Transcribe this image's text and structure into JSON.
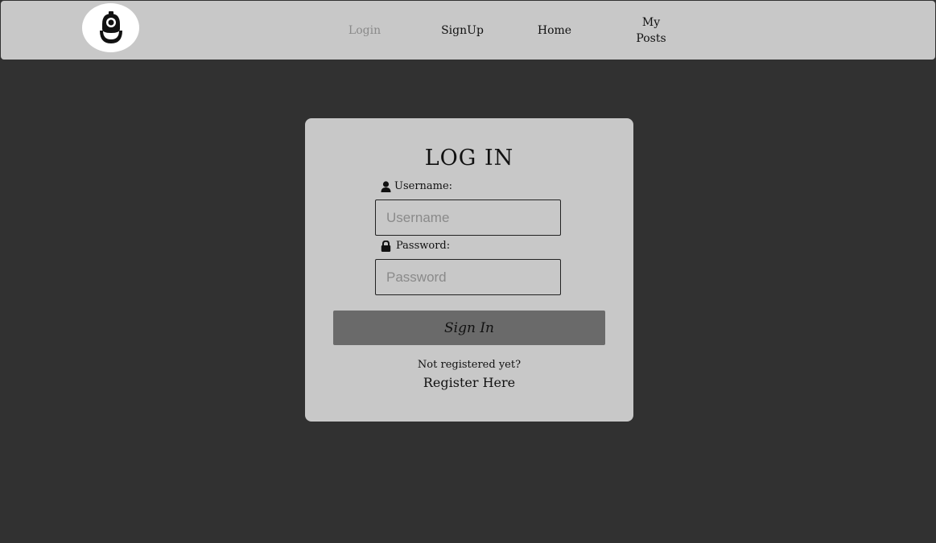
{
  "nav": {
    "logo_icon": "diving-helmet-icon",
    "links": {
      "login": "Login",
      "signup": "SignUp",
      "home": "Home",
      "my_posts_line1": "My",
      "my_posts_line2": "Posts"
    },
    "active": "login"
  },
  "login_form": {
    "title": "LOG IN",
    "username_label": "Username:",
    "username_icon": "user-icon",
    "username_placeholder": "Username",
    "username_value": "",
    "password_label": "Password:",
    "password_icon": "lock-icon",
    "password_placeholder": "Password",
    "password_value": "",
    "submit_label": "Sign In",
    "not_registered": "Not registered yet?",
    "register_link": "Register Here"
  },
  "colors": {
    "background": "#313131",
    "navbar": "#c8c8c8",
    "card": "#c8c8c8",
    "button": "#6a6a6a",
    "inactive_link": "#8a8a8a"
  }
}
